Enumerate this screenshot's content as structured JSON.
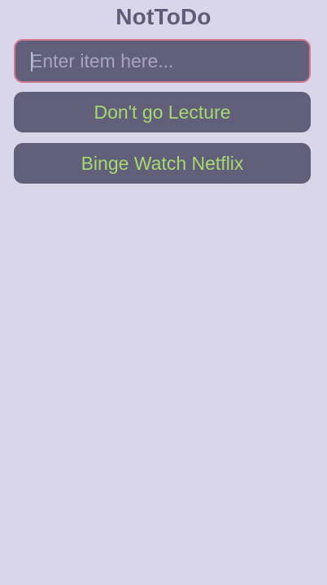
{
  "header": {
    "title": "NotToDo"
  },
  "input": {
    "placeholder": "Enter item here...",
    "value": ""
  },
  "items": [
    {
      "label": "Don't go Lecture"
    },
    {
      "label": "Binge Watch Netflix"
    }
  ],
  "colors": {
    "background": "#dad6ea",
    "card": "#625f7b",
    "title": "#5f5c79",
    "item_text": "#a6d96f",
    "input_border_focus": "#d07a8f"
  }
}
